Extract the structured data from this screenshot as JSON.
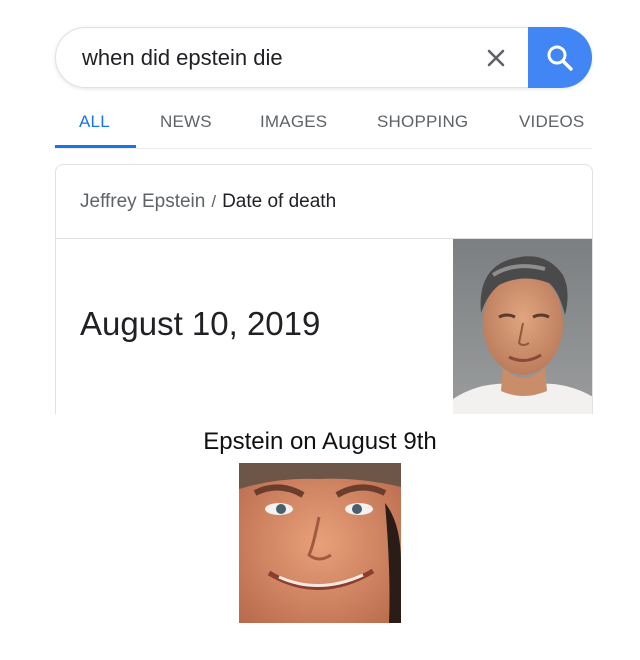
{
  "search": {
    "query": "when did epstein die",
    "clear_icon": "close-icon",
    "search_icon": "search-icon",
    "accent_color": "#4285f4"
  },
  "tabs": [
    {
      "label": "ALL",
      "active": true
    },
    {
      "label": "NEWS",
      "active": false
    },
    {
      "label": "IMAGES",
      "active": false
    },
    {
      "label": "SHOPPING",
      "active": false
    },
    {
      "label": "VIDEOS",
      "active": false
    }
  ],
  "answer_card": {
    "entity": "Jeffrey Epstein",
    "separator": "/",
    "attribute": "Date of death",
    "value": "August 10, 2019"
  },
  "caption": "Epstein on August 9th"
}
